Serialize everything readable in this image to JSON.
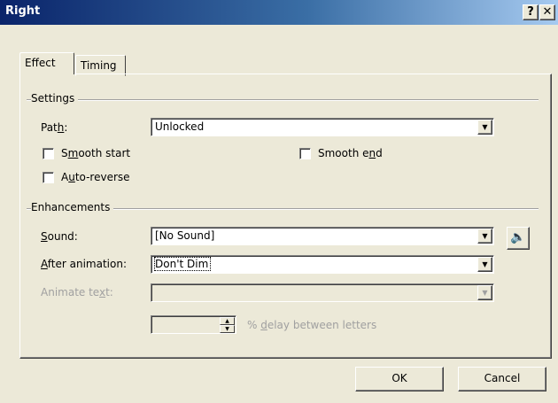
{
  "window": {
    "title": "Right",
    "help_label": "?",
    "close_label": "✕"
  },
  "tabs": [
    {
      "label": "Effect"
    },
    {
      "label": "Timing"
    }
  ],
  "settings": {
    "group_label": "Settings",
    "path_label": "Path:",
    "path_value": "Unlocked",
    "smooth_start_label": "Smooth start",
    "smooth_end_label": "Smooth end",
    "auto_reverse_label": "Auto-reverse",
    "smooth_start_checked": false,
    "smooth_end_checked": false,
    "auto_reverse_checked": false
  },
  "enhancements": {
    "group_label": "Enhancements",
    "sound_label": "Sound:",
    "sound_value": "[No Sound]",
    "after_animation_label": "After animation:",
    "after_animation_value": "Don't Dim",
    "animate_text_label": "Animate text:",
    "animate_text_value": "",
    "delay_value": "",
    "delay_label": "% delay between letters"
  },
  "buttons": {
    "ok": "OK",
    "cancel": "Cancel"
  },
  "icons": {
    "dropdown": "dropdown-arrow-icon",
    "speaker": "speaker-icon"
  }
}
